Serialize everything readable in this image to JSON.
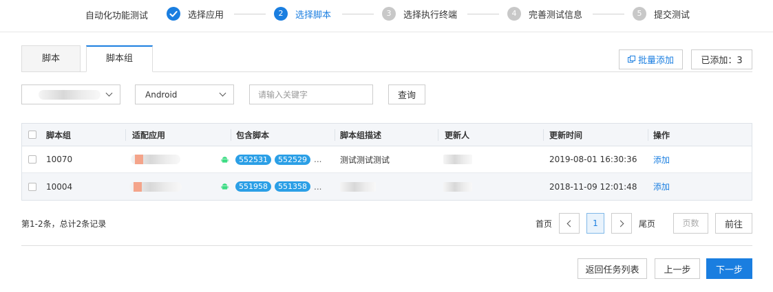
{
  "steps": {
    "title": "自动化功能测试",
    "items": [
      {
        "num": "",
        "label": "选择应用",
        "state": "done"
      },
      {
        "num": "2",
        "label": "选择脚本",
        "state": "active"
      },
      {
        "num": "3",
        "label": "选择执行终端",
        "state": "todo"
      },
      {
        "num": "4",
        "label": "完善测试信息",
        "state": "todo"
      },
      {
        "num": "5",
        "label": "提交测试",
        "state": "todo"
      }
    ]
  },
  "tabs": [
    {
      "label": "脚本",
      "active": false
    },
    {
      "label": "脚本组",
      "active": true
    }
  ],
  "toolbar": {
    "batch_add": "批量添加",
    "added_count": "已添加：3"
  },
  "filters": {
    "app_select": "",
    "platform_select": "Android",
    "keyword_placeholder": "请输入关键字",
    "query_label": "查询"
  },
  "table": {
    "headers": [
      "脚本组",
      "适配应用",
      "包含脚本",
      "脚本组描述",
      "更新人",
      "更新时间",
      "操作"
    ],
    "rows": [
      {
        "id": "10070",
        "scripts": [
          "552531",
          "552529"
        ],
        "more": "...",
        "desc": "测试测试测试",
        "time": "2019-08-01 16:30:36",
        "action": "添加"
      },
      {
        "id": "10004",
        "scripts": [
          "551958",
          "551358"
        ],
        "more": "...",
        "desc": "",
        "time": "2018-11-09 12:01:48",
        "action": "添加"
      }
    ]
  },
  "pager": {
    "summary": "第1-2条，总计2条记录",
    "first": "首页",
    "current": "1",
    "last": "尾页",
    "page_placeholder": "页数",
    "go": "前往"
  },
  "footer": {
    "back_to_list": "返回任务列表",
    "prev": "上一步",
    "next": "下一步"
  },
  "colors": {
    "accent": "#1a7ee0",
    "tag": "#2b9fe6",
    "android": "#3ddc84"
  }
}
